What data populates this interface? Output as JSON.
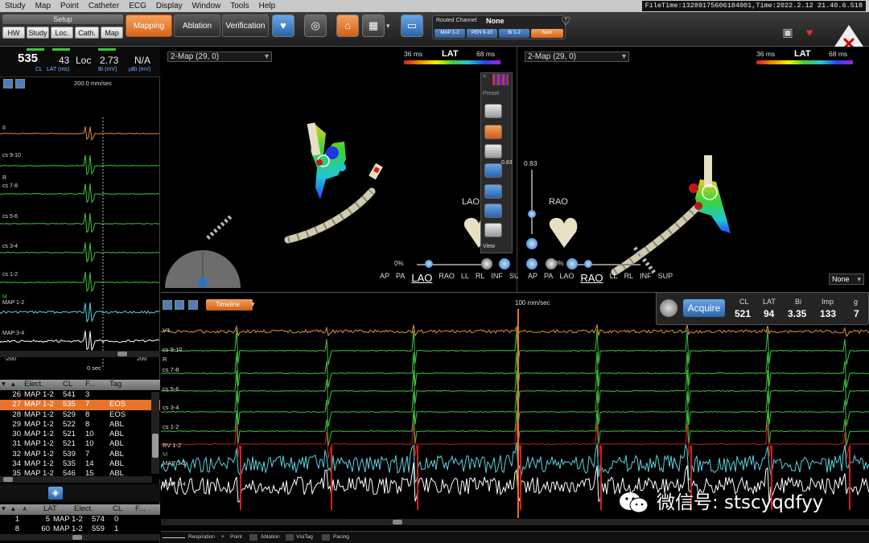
{
  "menu": [
    "Study",
    "Map",
    "Point",
    "Catheter",
    "ECG",
    "Display",
    "Window",
    "Tools",
    "Help"
  ],
  "filetime": "FileTime:1328917560618400​1,Time:2022.2.12 21.40.6.518",
  "toolbar": {
    "setup": "Setup",
    "setup_tabs": [
      "HW",
      "Study",
      "Loc.",
      "Cath.",
      "Map"
    ],
    "modes": [
      "Mapping",
      "Ablation",
      "Verification"
    ],
    "routed_label": "Routed Channel",
    "routed_value": "None",
    "chips": [
      "MAP 1-2",
      "PEN 9-10",
      "Bi 1-2",
      "Num"
    ]
  },
  "readout": {
    "cl_value": "535",
    "cl_label": "CL",
    "lat_value": "43",
    "lat_label": "LAT (ms)",
    "loc_label": "Loc",
    "bi_value": "2.73",
    "bi_label": "Bi (mV)",
    "ubi_value": "N/A",
    "ubi_label": "µBi (mV)"
  },
  "small_egm": {
    "speed": "200.0 mm/sec",
    "labels": [
      "II",
      "cs 9-10",
      "R",
      "cs 7-8",
      "cs 5-6",
      "cs 3-4",
      "cs 1-2",
      "M",
      "MAP 1-2",
      "MAP 3-4"
    ],
    "axis_left": "-200",
    "axis_right": "200",
    "axis_zero": "0 sec"
  },
  "point_table": {
    "headers": [
      "Elect.",
      "CL",
      "F...",
      "Tag"
    ],
    "rows": [
      {
        "n": "26",
        "elect": "MAP 1-2",
        "cl": "541",
        "f": "3",
        "tag": ""
      },
      {
        "n": "27",
        "elect": "MAP 1-2",
        "cl": "535",
        "f": "7",
        "tag": "EOS"
      },
      {
        "n": "28",
        "elect": "MAP 1-2",
        "cl": "529",
        "f": "8",
        "tag": "EOS"
      },
      {
        "n": "29",
        "elect": "MAP 1-2",
        "cl": "522",
        "f": "8",
        "tag": "ABL"
      },
      {
        "n": "30",
        "elect": "MAP 1-2",
        "cl": "521",
        "f": "10",
        "tag": "ABL"
      },
      {
        "n": "31",
        "elect": "MAP 1-2",
        "cl": "521",
        "f": "10",
        "tag": "ABL"
      },
      {
        "n": "32",
        "elect": "MAP 1-2",
        "cl": "539",
        "f": "7",
        "tag": "ABL"
      },
      {
        "n": "34",
        "elect": "MAP 1-2",
        "cl": "535",
        "f": "14",
        "tag": "ABL"
      },
      {
        "n": "35",
        "elect": "MAP 1-2",
        "cl": "546",
        "f": "15",
        "tag": "ABL"
      }
    ]
  },
  "lat_table": {
    "headers": [
      "LAT",
      "Elect.",
      "CL",
      "F..."
    ],
    "rows": [
      {
        "n": "1",
        "lat": "5",
        "elect": "MAP 1-2",
        "cl": "574",
        "f": "0"
      },
      {
        "n": "8",
        "lat": "60",
        "elect": "MAP 1-2",
        "cl": "559",
        "f": "1"
      }
    ]
  },
  "map_left": {
    "dropdown": "2-Map (29, 0)",
    "lat_min": "36 ms",
    "lat_max": "68 ms",
    "lat_title": "LAT",
    "view_label": "LAO",
    "views": [
      "AP",
      "PA",
      "LAO",
      "RAO",
      "LL",
      "RL",
      "INF",
      "SUP"
    ],
    "active_view": "LAO",
    "opacity": "0%",
    "palette_preset": "Preset",
    "palette_view": "View",
    "palette_value": "0.83"
  },
  "map_right": {
    "dropdown": "2-Map (29, 0)",
    "lat_min": "36 ms",
    "lat_max": "68 ms",
    "lat_title": "LAT",
    "view_label": "RAO",
    "views": [
      "AP",
      "PA",
      "LAO",
      "RAO",
      "LL",
      "RL",
      "INF",
      "SUP"
    ],
    "active_view": "RAO",
    "opacity": "0%",
    "slider_value": "0.83",
    "none_dd": "None"
  },
  "strip": {
    "timeline_label": "Timeline",
    "speed": "100 mm/sec",
    "labels": [
      "V1",
      "cs 9-10",
      "R",
      "cs 7-8",
      "cs 5-6",
      "cs 3-4",
      "cs 1-2",
      "RV 1-2",
      "M",
      "MAP 1-2",
      "MAP 3-4"
    ]
  },
  "acquire": {
    "button": "Acquire",
    "headers": [
      "CL",
      "LAT",
      "Bi",
      "Imp",
      "g"
    ],
    "values": [
      "521",
      "94",
      "3.35",
      "133",
      "7"
    ]
  },
  "footer": [
    "Respiration",
    "Point",
    "Ablation",
    "VisiTag",
    "Pacing"
  ],
  "watermark": "微信号: stscyqdfyy",
  "colors": {
    "accent_orange": "#e8742b",
    "accent_blue": "#2f74c0",
    "egm_green": "#3ec43e",
    "egm_orange": "#e09040",
    "egm_cyan": "#5ad0e0",
    "egm_red": "#c02020"
  }
}
